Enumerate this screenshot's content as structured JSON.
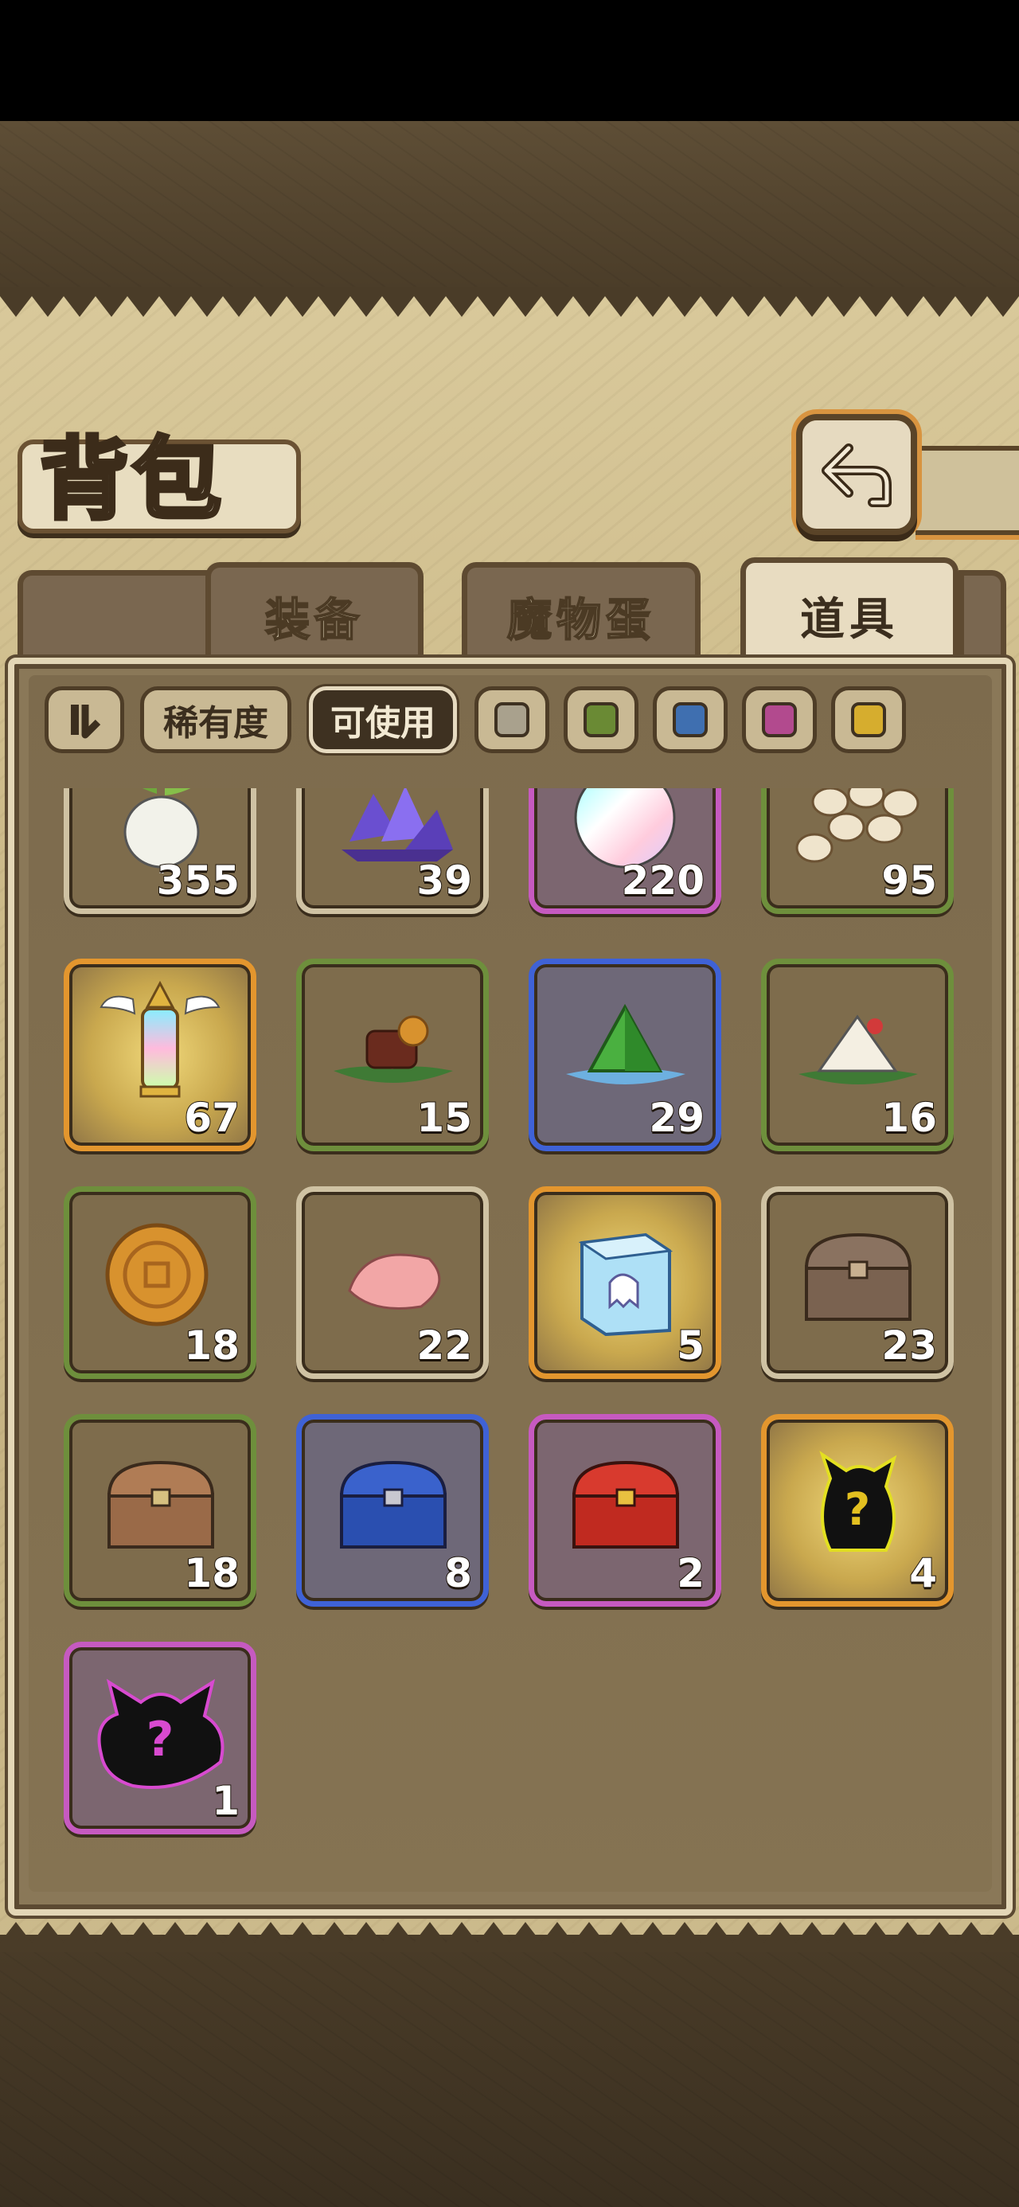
{
  "title": "背包",
  "tabs": [
    {
      "label": "装备",
      "active": false
    },
    {
      "label": "魔物蛋",
      "active": false
    },
    {
      "label": "道具",
      "active": true
    }
  ],
  "filters": {
    "sort_icon": "sort-icon",
    "rarity_label": "稀有度",
    "usable_label": "可使用",
    "usable_selected": true,
    "color_swatches": [
      {
        "name": "grey",
        "color": "#a9a18d"
      },
      {
        "name": "green",
        "color": "#6a8a34"
      },
      {
        "name": "blue",
        "color": "#3f6fb0"
      },
      {
        "name": "purple",
        "color": "#b24a8e"
      },
      {
        "name": "gold",
        "color": "#d6ad2e"
      }
    ]
  },
  "items": [
    {
      "icon": "radish-icon",
      "count": "355",
      "rarity": "grey"
    },
    {
      "icon": "crystal-cluster-icon",
      "count": "39",
      "rarity": "grey"
    },
    {
      "icon": "rainbow-egg-icon",
      "count": "220",
      "rarity": "purple"
    },
    {
      "icon": "beans-icon",
      "count": "95",
      "rarity": "green"
    },
    {
      "icon": "winged-lantern-icon",
      "count": "67",
      "rarity": "orange"
    },
    {
      "icon": "chocolate-cake-icon",
      "count": "15",
      "rarity": "green"
    },
    {
      "icon": "green-crystal-icon",
      "count": "29",
      "rarity": "blue"
    },
    {
      "icon": "rice-dumpling-icon",
      "count": "16",
      "rarity": "green"
    },
    {
      "icon": "mooncake-icon",
      "count": "18",
      "rarity": "green"
    },
    {
      "icon": "pink-petal-icon",
      "count": "22",
      "rarity": "grey"
    },
    {
      "icon": "ghost-box-icon",
      "count": "5",
      "rarity": "orange"
    },
    {
      "icon": "wooden-chest-icon",
      "count": "23",
      "rarity": "grey"
    },
    {
      "icon": "bronze-chest-icon",
      "count": "18",
      "rarity": "green"
    },
    {
      "icon": "blue-chest-icon",
      "count": "8",
      "rarity": "blue"
    },
    {
      "icon": "red-chest-icon",
      "count": "2",
      "rarity": "purple"
    },
    {
      "icon": "mystery-monster-icon",
      "count": "4",
      "rarity": "orange"
    },
    {
      "icon": "mystery-demon-icon",
      "count": "1",
      "rarity": "purple"
    }
  ],
  "colors": {
    "border_green": "#6e8f3c",
    "border_blue": "#3f62d6",
    "border_purple": "#c65ac0",
    "border_orange": "#e3962e",
    "border_grey": "#cfc2a3"
  }
}
